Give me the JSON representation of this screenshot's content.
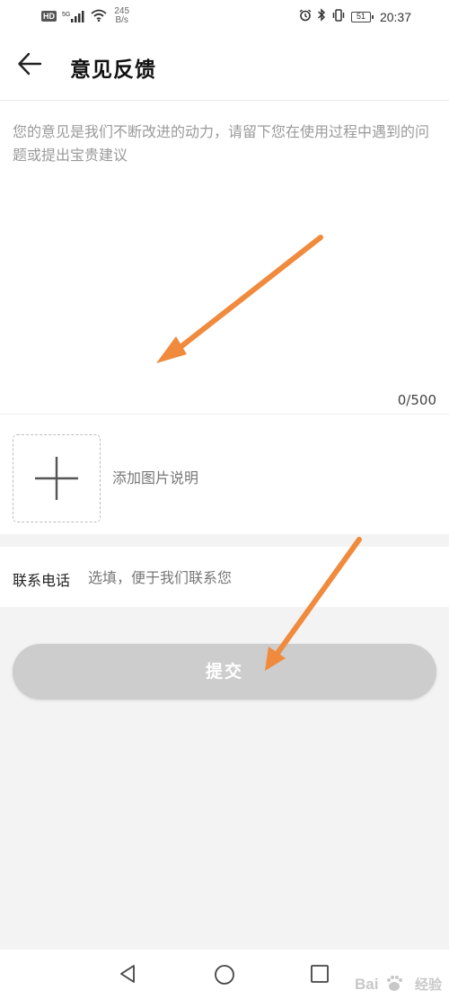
{
  "status_bar": {
    "hd_badge": "HD",
    "network_type": "5G",
    "speed_value": "245",
    "speed_unit": "B/s",
    "battery_level": "51",
    "time": "20:37",
    "icons": [
      "signal-icon",
      "wifi-icon",
      "alarm-icon",
      "bluetooth-icon",
      "vibrate-icon",
      "battery-icon"
    ]
  },
  "header": {
    "title": "意见反馈",
    "back_icon": "arrow-left-icon"
  },
  "feedback": {
    "value": "",
    "placeholder": "您的意见是我们不断改进的动力，请留下您在使用过程中遇到的问题或提出宝贵建议",
    "char_count": "0/500"
  },
  "image_upload": {
    "icon": "plus-icon",
    "label": "添加图片说明"
  },
  "contact": {
    "label": "联系电话",
    "value": "",
    "placeholder": "选填，便于我们联系您"
  },
  "submit": {
    "label": "提交"
  },
  "nav_bar": {
    "icons": [
      "triangle-back-icon",
      "circle-home-icon",
      "square-recents-icon"
    ]
  },
  "watermark": {
    "text": "经验"
  },
  "colors": {
    "annotation_arrow": "#f08a3c",
    "submit_disabled": "#cdcdcd",
    "background": "#f3f3f3"
  }
}
